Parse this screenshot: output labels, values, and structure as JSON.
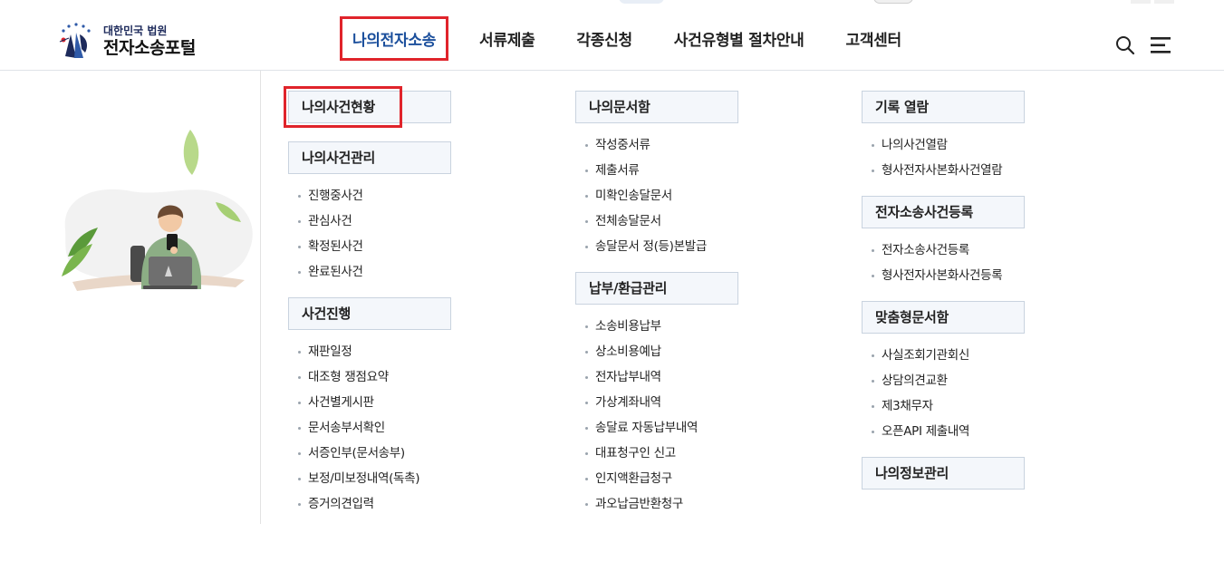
{
  "logo": {
    "sub": "대한민국 법원",
    "main": "전자소송포털"
  },
  "gnb": [
    {
      "label": "나의전자소송"
    },
    {
      "label": "서류제출"
    },
    {
      "label": "각종신청"
    },
    {
      "label": "사건유형별 절차안내"
    },
    {
      "label": "고객센터"
    }
  ],
  "columns": [
    {
      "groups": [
        {
          "title": "나의사건현황",
          "items": []
        },
        {
          "title": "나의사건관리",
          "items": [
            "진행중사건",
            "관심사건",
            "확정된사건",
            "완료된사건"
          ]
        },
        {
          "title": "사건진행",
          "items": [
            "재판일정",
            "대조형 쟁점요약",
            "사건별게시판",
            "문서송부서확인",
            "서증인부(문서송부)",
            "보정/미보정내역(독촉)",
            "증거의견입력"
          ]
        }
      ]
    },
    {
      "groups": [
        {
          "title": "나의문서함",
          "items": [
            "작성중서류",
            "제출서류",
            "미확인송달문서",
            "전체송달문서",
            "송달문서 정(등)본발급"
          ]
        },
        {
          "title": "납부/환급관리",
          "items": [
            "소송비용납부",
            "상소비용예납",
            "전자납부내역",
            "가상계좌내역",
            "송달료 자동납부내역",
            "대표청구인 신고",
            "인지액환급청구",
            "과오납금반환청구"
          ]
        }
      ]
    },
    {
      "groups": [
        {
          "title": "기록 열람",
          "items": [
            "나의사건열람",
            "형사전자사본화사건열람"
          ]
        },
        {
          "title": "전자소송사건등록",
          "items": [
            "전자소송사건등록",
            "형사전자사본화사건등록"
          ]
        },
        {
          "title": "맞춤형문서함",
          "items": [
            "사실조회기관회신",
            "상담의견교환",
            "제3채무자",
            "오픈API 제출내역"
          ]
        },
        {
          "title": "나의정보관리",
          "items": []
        }
      ]
    }
  ],
  "icons": {
    "search": "search-icon",
    "menu": "hamburger-menu-icon"
  },
  "colors": {
    "active_nav": "#1b4f9c",
    "highlight": "#e0242b",
    "group_bg": "#f4f7fb"
  }
}
